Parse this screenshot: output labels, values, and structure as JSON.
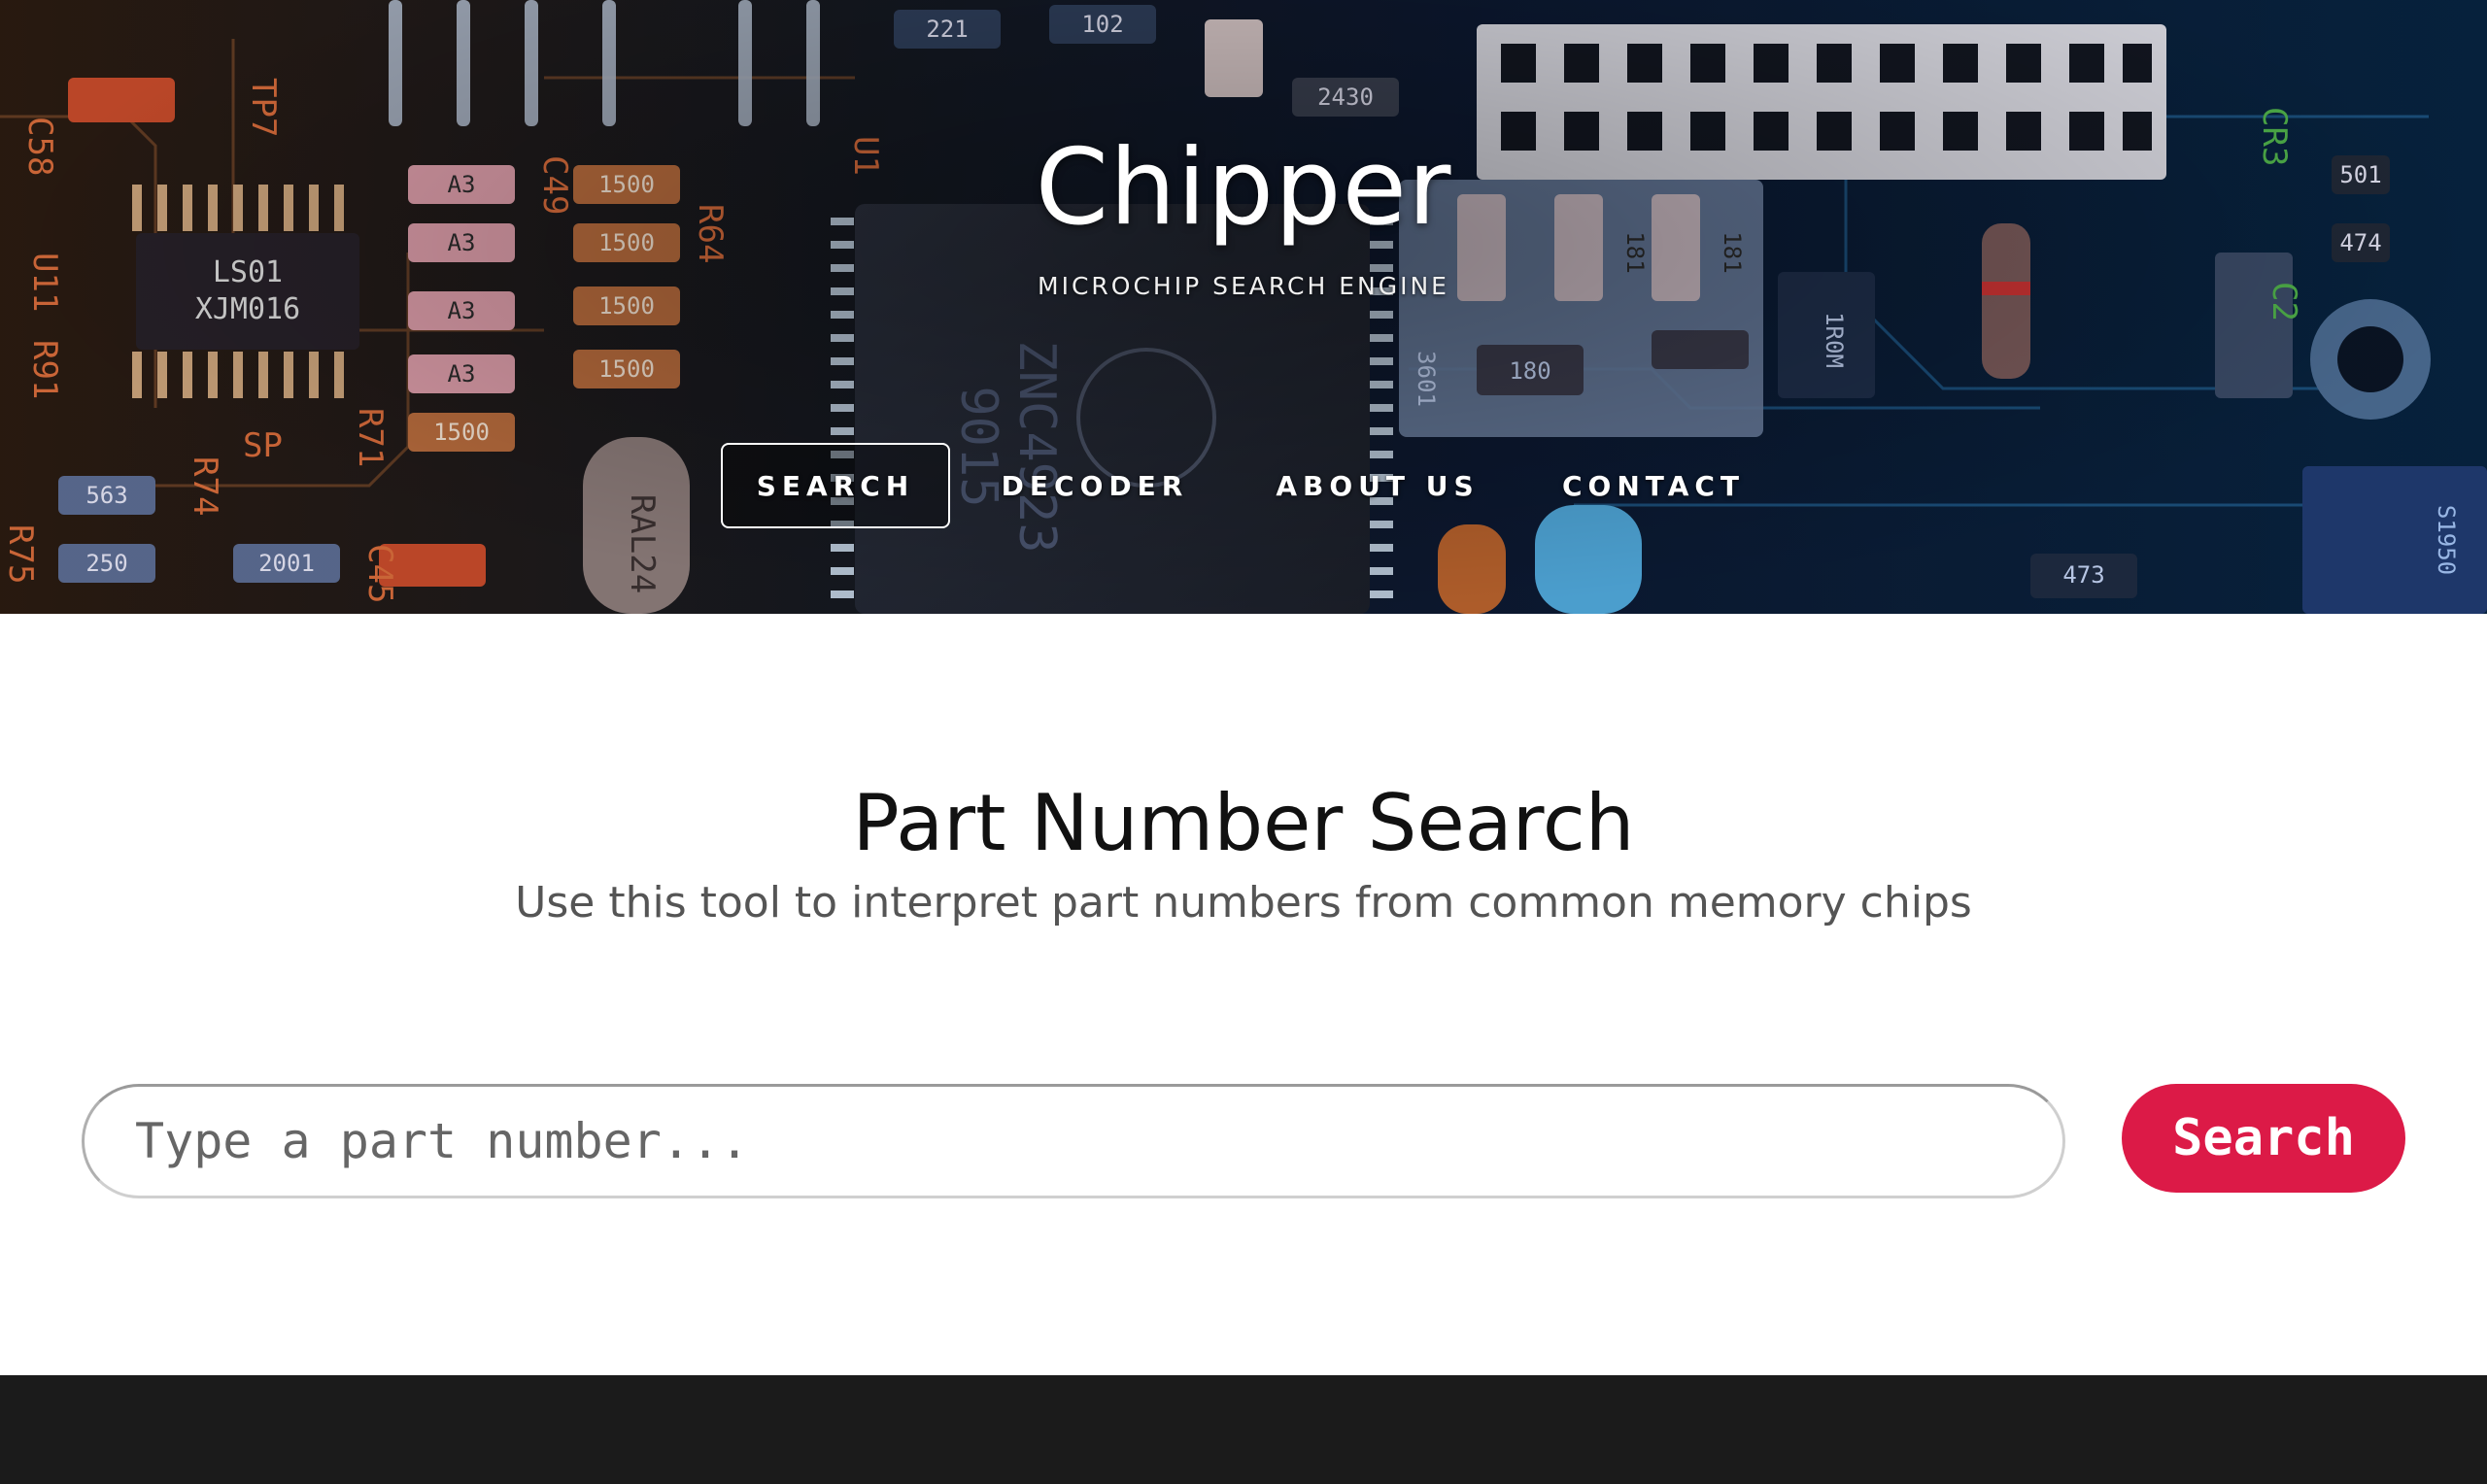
{
  "brand": {
    "title": "Chipper",
    "tagline": "MICROCHIP SEARCH ENGINE"
  },
  "nav": {
    "items": [
      {
        "label": "SEARCH",
        "active": true
      },
      {
        "label": "DECODER",
        "active": false
      },
      {
        "label": "ABOUT US",
        "active": false
      },
      {
        "label": "CONTACT",
        "active": false
      }
    ]
  },
  "main": {
    "title": "Part Number Search",
    "subtitle": "Use this tool to interpret part numbers from common memory chips",
    "search": {
      "placeholder": "Type a part number...",
      "value": "",
      "button_label": "Search"
    }
  },
  "board_markings": {
    "left_chip": [
      "LS01",
      "XJM016"
    ],
    "center_chip": [
      "ZNC4923",
      "9015"
    ],
    "crystal": "RAL24",
    "labels": [
      "C58",
      "TP7",
      "U11",
      "R91",
      "R75",
      "R74",
      "R71",
      "C49",
      "C45",
      "R64",
      "U1",
      "SP",
      "CR3",
      "C2"
    ],
    "resistors": [
      "A3",
      "A3",
      "A3",
      "A3",
      "1500",
      "1500",
      "1500",
      "1500",
      "1500",
      "563",
      "250",
      "2001",
      "221",
      "102",
      "2430",
      "181",
      "181",
      "180",
      "3601",
      "1R0M",
      "501",
      "474",
      "473",
      "S1950"
    ]
  },
  "colors": {
    "accent": "#dc1a47",
    "footer": "#1b1b1b",
    "title_text": "#111111",
    "subtitle_text": "#555555"
  }
}
